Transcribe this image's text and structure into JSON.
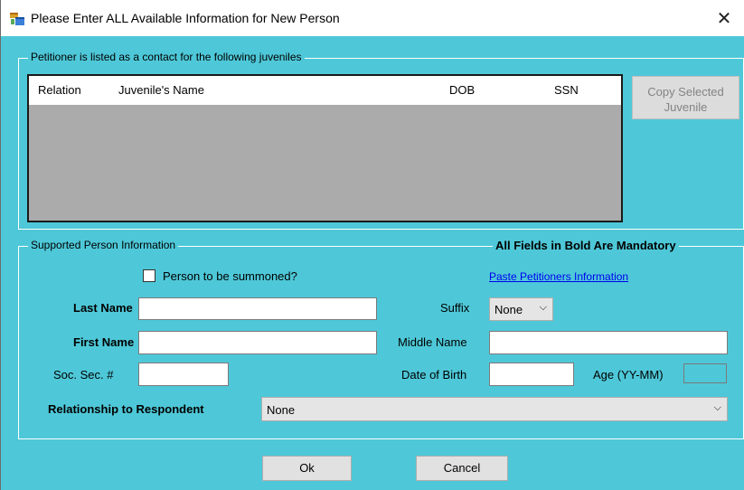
{
  "window": {
    "title": "Please Enter ALL Available Information for New Person",
    "close_glyph": "✕"
  },
  "juveniles_group": {
    "label": "Petitioner is listed as a contact for the following juveniles",
    "columns": [
      "Relation",
      "Juvenile's Name",
      "DOB",
      "SSN"
    ],
    "rows": [],
    "copy_button": "Copy Selected Juvenile"
  },
  "person_group": {
    "label": "Supported Person Information",
    "mandatory_note": "All Fields in Bold Are Mandatory",
    "summoned_label": "Person to be summoned?",
    "summoned_checked": false,
    "paste_link": "Paste Petitioners Information",
    "last_name_label": "Last Name",
    "last_name_value": "",
    "first_name_label": "First Name",
    "first_name_value": "",
    "ssn_label": "Soc. Sec. #",
    "ssn_value": "",
    "suffix_label": "Suffix",
    "suffix_value": "None",
    "middle_name_label": "Middle Name",
    "middle_name_value": "",
    "dob_label": "Date of Birth",
    "dob_value": "",
    "age_label": "Age (YY-MM)",
    "age_value": "",
    "relationship_label": "Relationship to Respondent",
    "relationship_value": "None"
  },
  "buttons": {
    "ok": "Ok",
    "cancel": "Cancel"
  },
  "colors": {
    "background": "#4ec8d8",
    "grid": "#ababab",
    "link": "#0000ee"
  }
}
